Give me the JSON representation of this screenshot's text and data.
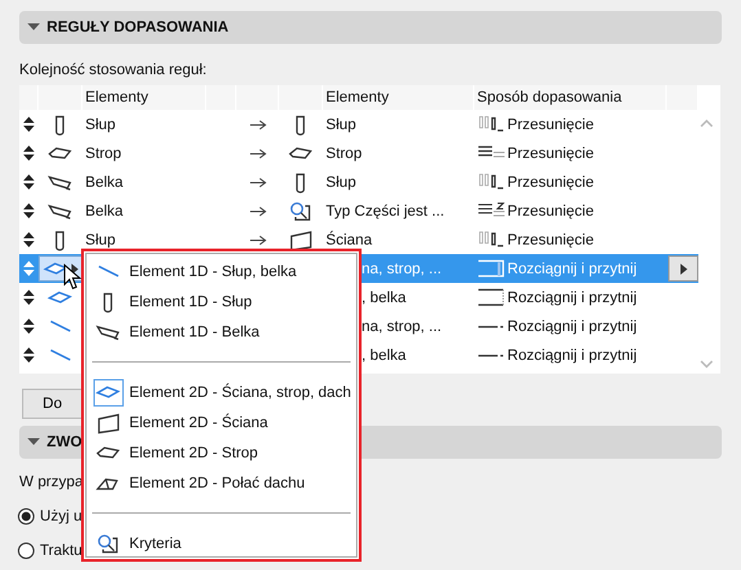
{
  "section_1": {
    "title": "REGUŁY DOPASOWANIA",
    "expanded": true
  },
  "order_label": "Kolejność stosowania reguł:",
  "table": {
    "columns": [
      "Elementy",
      "Elementy",
      "Sposób dopasowania"
    ],
    "rows": [
      {
        "source": "Słup",
        "target": "Słup",
        "method": "Przesunięcie",
        "selected": false
      },
      {
        "source": "Strop",
        "target": "Strop",
        "method": "Przesunięcie",
        "selected": false
      },
      {
        "source": "Belka",
        "target": "Słup",
        "method": "Przesunięcie",
        "selected": false
      },
      {
        "source": "Belka",
        "target": "Typ Części jest ...",
        "method": "Przesunięcie",
        "selected": false
      },
      {
        "source": "Słup",
        "target": "Ściana",
        "method": "Przesunięcie",
        "selected": false
      },
      {
        "target": "na, strop, ...",
        "method": "Rozciągnij i przytnij",
        "selected": true,
        "menu_open": true
      },
      {
        "target": ", belka",
        "method": "Rozciągnij i przytnij",
        "selected": false
      },
      {
        "target": "na, strop, ...",
        "method": "Rozciągnij i przytnij",
        "selected": false
      },
      {
        "target": ", belka",
        "method": "Rozciągnij i przytnij",
        "selected": false
      }
    ]
  },
  "add_button": "Do",
  "section_2": {
    "title": "ZWO",
    "expanded": true
  },
  "case_label": "W przypa",
  "radios": [
    {
      "label": "Użyj u",
      "selected": true
    },
    {
      "label": "Traktu",
      "selected": false
    }
  ],
  "popup": {
    "groups": [
      [
        {
          "label": "Element 1D - Słup, belka",
          "selected": false
        },
        {
          "label": "Element 1D - Słup",
          "selected": false
        },
        {
          "label": "Element 1D - Belka",
          "selected": false
        }
      ],
      [
        {
          "label": "Element 2D - Ściana, strop, dach",
          "selected": true
        },
        {
          "label": "Element 2D - Ściana",
          "selected": false
        },
        {
          "label": "Element 2D - Strop",
          "selected": false
        },
        {
          "label": "Element 2D - Połać dachu",
          "selected": false
        }
      ],
      [
        {
          "label": "Kryteria",
          "selected": false
        }
      ]
    ]
  }
}
